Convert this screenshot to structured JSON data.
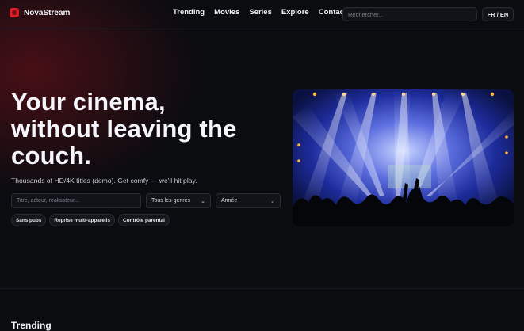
{
  "header": {
    "brand": "NovaStream",
    "nav": [
      "Trending",
      "Movies",
      "Series",
      "Explore",
      "Contact"
    ],
    "search_placeholder": "Rechercher...",
    "lang_toggle": "FR / EN"
  },
  "hero": {
    "title_lines": [
      "Your cinema,",
      "without leaving the",
      "couch."
    ],
    "subtitle": "Thousands of HD/4K titles (demo). Get comfy — we'll hit play.",
    "search_placeholder": "Titre, acteur, réalisateur...",
    "genre_select": "Tous les genres",
    "year_select": "Année",
    "chips": [
      "Sans pubs",
      "Reprise multi-appareils",
      "Contrôle parental"
    ],
    "image": "concert-stage-lights-photo"
  },
  "section": {
    "title": "Trending"
  },
  "colors": {
    "background": "#0b0c10",
    "brand_red": "#d81f2a",
    "text": "#f3f5fa"
  }
}
